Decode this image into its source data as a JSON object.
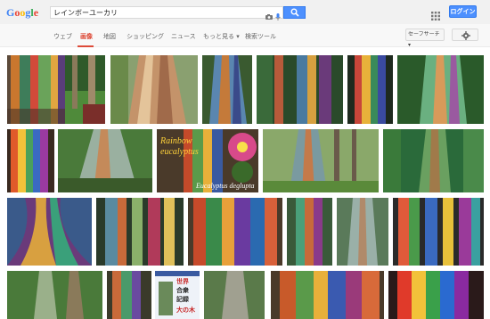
{
  "search": {
    "query": "レインボーユーカリ"
  },
  "header": {
    "login_label": "ログイン"
  },
  "tabs": [
    {
      "label": "ウェブ"
    },
    {
      "label": "画像"
    },
    {
      "label": "地図"
    },
    {
      "label": "ショッピング"
    },
    {
      "label": "ニュース"
    },
    {
      "label": "もっと見る ▾"
    },
    {
      "label": "検索ツール"
    }
  ],
  "toolbar": {
    "safesearch_label": "セーフサーチ ▾"
  },
  "results": {
    "captions": {
      "rainbow_line1": "Rainbow",
      "rainbow_line2": "eucalyptus",
      "species": "Eucalyptus deglupta",
      "jp_line1": "世界",
      "jp_line2": "合衆",
      "jp_line3": "記録",
      "jp_line4": "大の木"
    }
  },
  "colors": {
    "accent_blue": "#4d90fe",
    "active_tab": "#dd4b39"
  }
}
